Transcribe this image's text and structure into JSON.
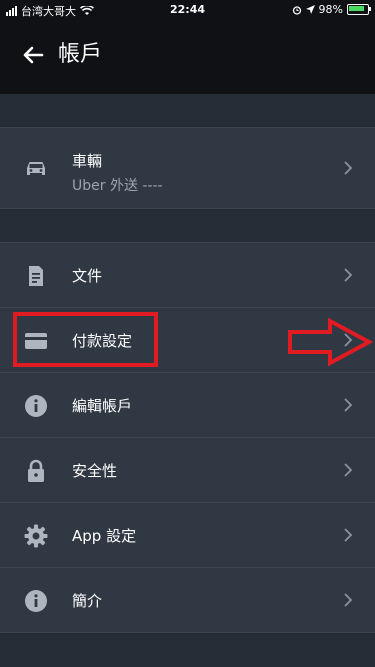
{
  "status": {
    "carrier": "台湾大哥大",
    "time": "22:44",
    "battery": "98%"
  },
  "header": {
    "title": "帳戶"
  },
  "vehicle": {
    "label": "車輛",
    "subtitle": "Uber 外送 ----"
  },
  "menu": {
    "items": [
      {
        "label": "文件",
        "icon": "document-icon"
      },
      {
        "label": "付款設定",
        "icon": "card-icon"
      },
      {
        "label": "編輯帳戶",
        "icon": "info-icon"
      },
      {
        "label": "安全性",
        "icon": "lock-icon"
      },
      {
        "label": "App 設定",
        "icon": "gear-icon"
      },
      {
        "label": "簡介",
        "icon": "info-icon"
      }
    ]
  },
  "annotation": {
    "highlight_color": "#e01b22"
  }
}
